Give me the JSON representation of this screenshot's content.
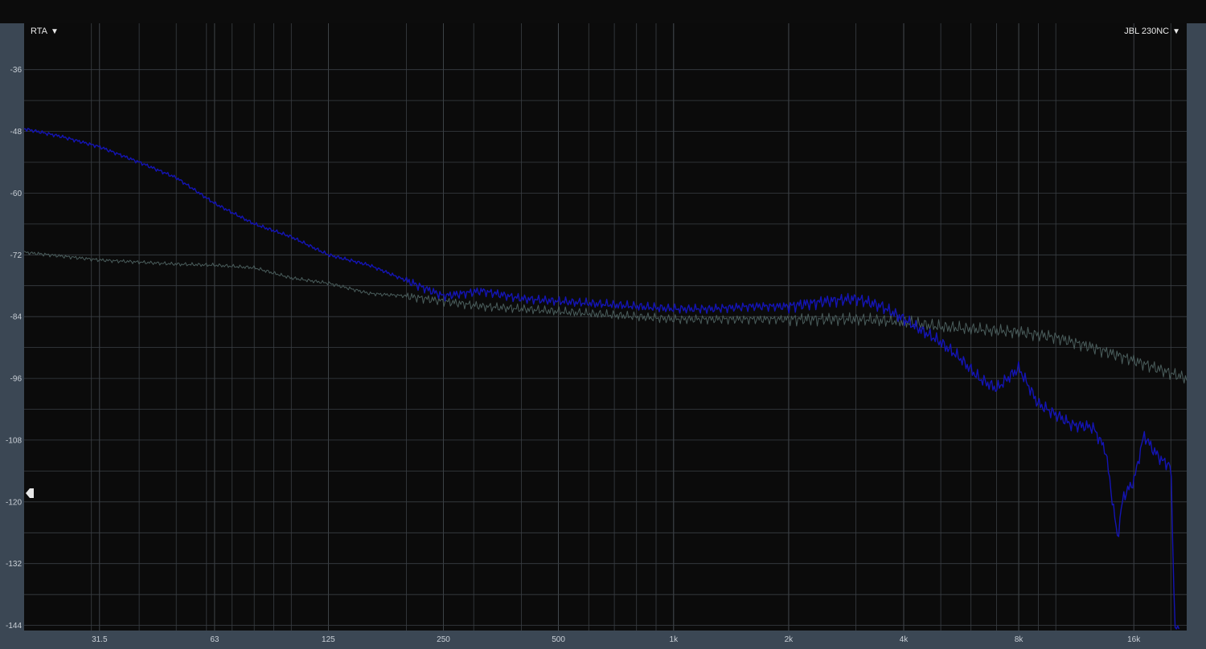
{
  "header": {
    "mode_label": "RTA",
    "device_label": "JBL 230NC",
    "dropdown_glyph": "▼"
  },
  "colors": {
    "background": "#0b0b0b",
    "frame": "#3b4754",
    "grid": "#3a3f44",
    "series_blue": "#1414b4",
    "series_gray": "#4a5d5c"
  },
  "icons": {
    "reference_marker": "level-marker-icon"
  },
  "chart_data": {
    "type": "line",
    "x_scale": "log",
    "xlim": [
      20,
      22000
    ],
    "ylim": [
      -145,
      -27
    ],
    "grid": true,
    "y_ticks": [
      -36,
      -48,
      -60,
      -72,
      -84,
      -96,
      -108,
      -120,
      -132,
      -144
    ],
    "y_tick_labels": [
      "-36",
      "-48",
      "-60",
      "-72",
      "-84",
      "-96",
      "-108",
      "-120",
      "-132",
      "-144"
    ],
    "x_ticks": [
      31.5,
      63,
      125,
      250,
      500,
      1000,
      2000,
      4000,
      8000,
      16000
    ],
    "x_tick_labels": [
      "31.5",
      "63",
      "125",
      "250",
      "500",
      "1k",
      "2k",
      "4k",
      "8k",
      "16k"
    ],
    "reference_level": -120,
    "series": [
      {
        "color": "#1414b4",
        "x": [
          20,
          25,
          31.5,
          40,
          50,
          63,
          80,
          100,
          125,
          160,
          200,
          250,
          315,
          400,
          500,
          630,
          800,
          1000,
          1250,
          1600,
          2000,
          2500,
          3000,
          3500,
          4000,
          5000,
          5600,
          6300,
          7000,
          8000,
          9000,
          10000,
          11000,
          12500,
          13500,
          14500,
          15000,
          16000,
          17000,
          18000,
          19000,
          20000,
          20500,
          21000
        ],
        "y": [
          -47.5,
          -49,
          -51,
          -54,
          -57,
          -62,
          -66,
          -68.5,
          -72,
          -74,
          -77,
          -80,
          -79,
          -80.5,
          -81,
          -81.5,
          -82,
          -82.5,
          -82.5,
          -82,
          -82,
          -81,
          -80.5,
          -82,
          -84.5,
          -89,
          -92,
          -96,
          -98,
          -94,
          -101,
          -103,
          -105,
          -105.5,
          -110,
          -127,
          -119,
          -116,
          -107,
          -110,
          -112,
          -113,
          -145,
          -145
        ]
      },
      {
        "color": "#4a5d5c",
        "x": [
          20,
          31.5,
          50,
          63,
          80,
          100,
          125,
          160,
          200,
          250,
          315,
          400,
          500,
          630,
          800,
          1000,
          1250,
          1600,
          2000,
          2500,
          3000,
          4000,
          5000,
          6300,
          8000,
          10000,
          12500,
          16000,
          20000,
          22000
        ],
        "y": [
          -71.5,
          -73,
          -73.8,
          -74,
          -74.5,
          -76.5,
          -77.5,
          -79.5,
          -80,
          -81,
          -82,
          -82.5,
          -83,
          -83.5,
          -84,
          -84.5,
          -84.5,
          -84.5,
          -84.5,
          -84.5,
          -84.5,
          -85,
          -86,
          -86.5,
          -87,
          -88,
          -90,
          -92.5,
          -95,
          -96
        ]
      }
    ]
  }
}
